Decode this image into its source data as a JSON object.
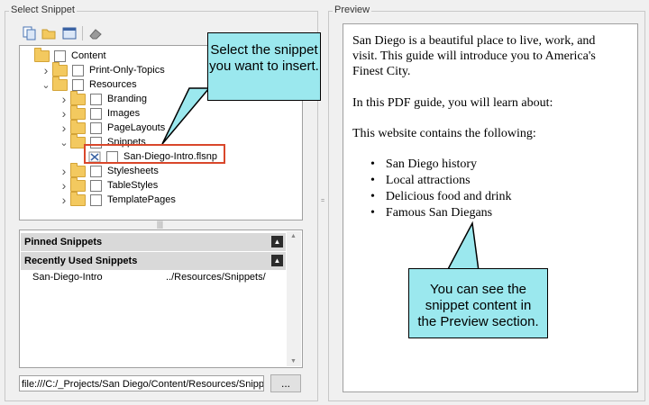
{
  "left_panel": {
    "title": "Select Snippet",
    "toolbar": [
      {
        "icon": "copy-icon"
      },
      {
        "icon": "open-folder-icon"
      },
      {
        "icon": "window-icon"
      },
      {
        "icon": "eraser-icon"
      }
    ],
    "tree": [
      {
        "label": "Content",
        "level": 0,
        "chevron": "",
        "type": "folder"
      },
      {
        "label": "Print-Only-Topics",
        "level": 1,
        "chevron": ">",
        "type": "folder"
      },
      {
        "label": "Resources",
        "level": 1,
        "chevron": "v",
        "type": "folder"
      },
      {
        "label": "Branding",
        "level": 2,
        "chevron": ">",
        "type": "folder"
      },
      {
        "label": "Images",
        "level": 2,
        "chevron": ">",
        "type": "folder"
      },
      {
        "label": "PageLayouts",
        "level": 2,
        "chevron": ">",
        "type": "folder"
      },
      {
        "label": "Snippets",
        "level": 2,
        "chevron": "v",
        "type": "folder"
      },
      {
        "label": "San-Diego-Intro.flsnp",
        "level": 3,
        "chevron": "",
        "type": "snippet",
        "selected": true
      },
      {
        "label": "Stylesheets",
        "level": 2,
        "chevron": ">",
        "type": "folder"
      },
      {
        "label": "TableStyles",
        "level": 2,
        "chevron": ">",
        "type": "folder"
      },
      {
        "label": "TemplatePages",
        "level": 2,
        "chevron": ">",
        "type": "folder"
      }
    ],
    "pinned_header": "Pinned Snippets",
    "recent_header": "Recently Used Snippets",
    "recent_items": [
      {
        "name": "San-Diego-Intro",
        "path": "../Resources/Snippets/"
      }
    ],
    "path_value": "file:///C:/_Projects/San Diego/Content/Resources/Snippets/San-Diego-Intro.flsnp",
    "browse_label": "..."
  },
  "preview": {
    "title": "Preview",
    "para1": "San Diego is a beautiful place to live, work, and visit. This guide will introduce you to America's Finest City.",
    "para2": "In this PDF guide, you will learn about:",
    "para3": "This website contains the following:",
    "bullets": [
      "San Diego history",
      "Local attractions",
      "Delicious food and drink",
      "Famous San Diegans"
    ]
  },
  "callouts": {
    "left": "Select the snippet you want to insert.",
    "right": "You can see the snippet content in the Preview section."
  },
  "colors": {
    "callout_fill": "#9be8ee",
    "selection_border": "#d9472b",
    "folder": "#f3c95f"
  }
}
